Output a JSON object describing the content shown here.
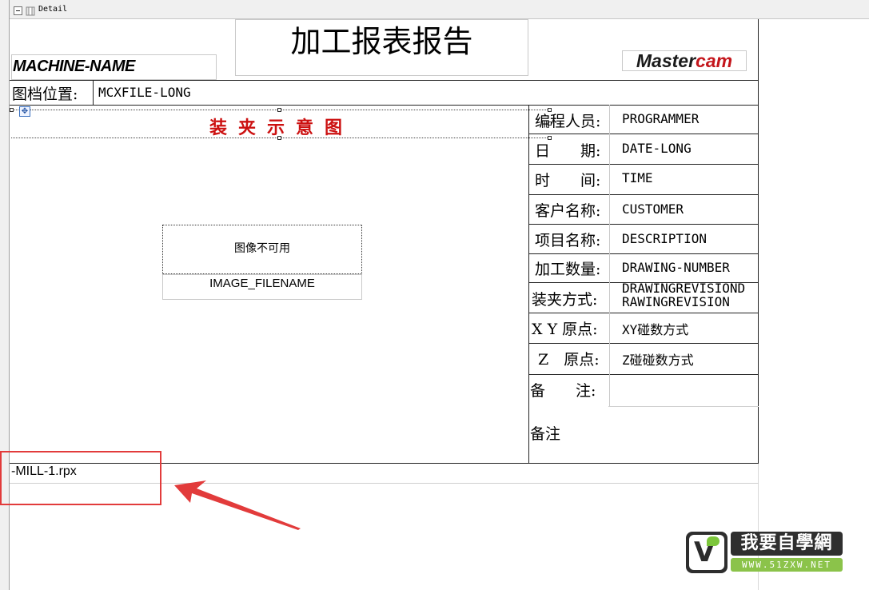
{
  "band": {
    "label": "Detail"
  },
  "header": {
    "title": "加工报表报告",
    "machine_name": "MACHINE-NAME",
    "logo_main": "Master",
    "logo_accent": "cam"
  },
  "file_location": {
    "label": "图档位置:",
    "value": "MCXFILE-LONG"
  },
  "fixture": {
    "title": "装夹示意图",
    "image_placeholder": "图像不可用",
    "image_filename": "IMAGE_FILENAME",
    "move_handle": "✥"
  },
  "info_rows": [
    {
      "label": "编程人员:",
      "value": "PROGRAMMER"
    },
    {
      "label": "日　　期:",
      "value": "DATE-LONG"
    },
    {
      "label": "时　　间:",
      "value": "TIME"
    },
    {
      "label": "客户名称:",
      "value": "CUSTOMER"
    },
    {
      "label": "项目名称:",
      "value": "DESCRIPTION"
    },
    {
      "label": "加工数量:",
      "value": "DRAWING-NUMBER"
    },
    {
      "label": "装夹方式:",
      "value_line1": "DRAWINGREVISIOND",
      "value_line2": "RAWINGREVISION"
    },
    {
      "label": "X Y 原点:",
      "value": "XY碰数方式"
    },
    {
      "label": "Z　原点:",
      "value": "Z碰碰数方式"
    },
    {
      "label": "备　　注:",
      "value": ""
    }
  ],
  "notes": {
    "text": "备注"
  },
  "footer": {
    "filename": "-MILL-1.rpx"
  },
  "annotation": {
    "box_color": "#e23b3b",
    "arrow_color": "#e23b3b"
  },
  "watermark": {
    "badge_letter": "V",
    "title": "我要自學網",
    "url": "WWW.51ZXW.NET"
  }
}
